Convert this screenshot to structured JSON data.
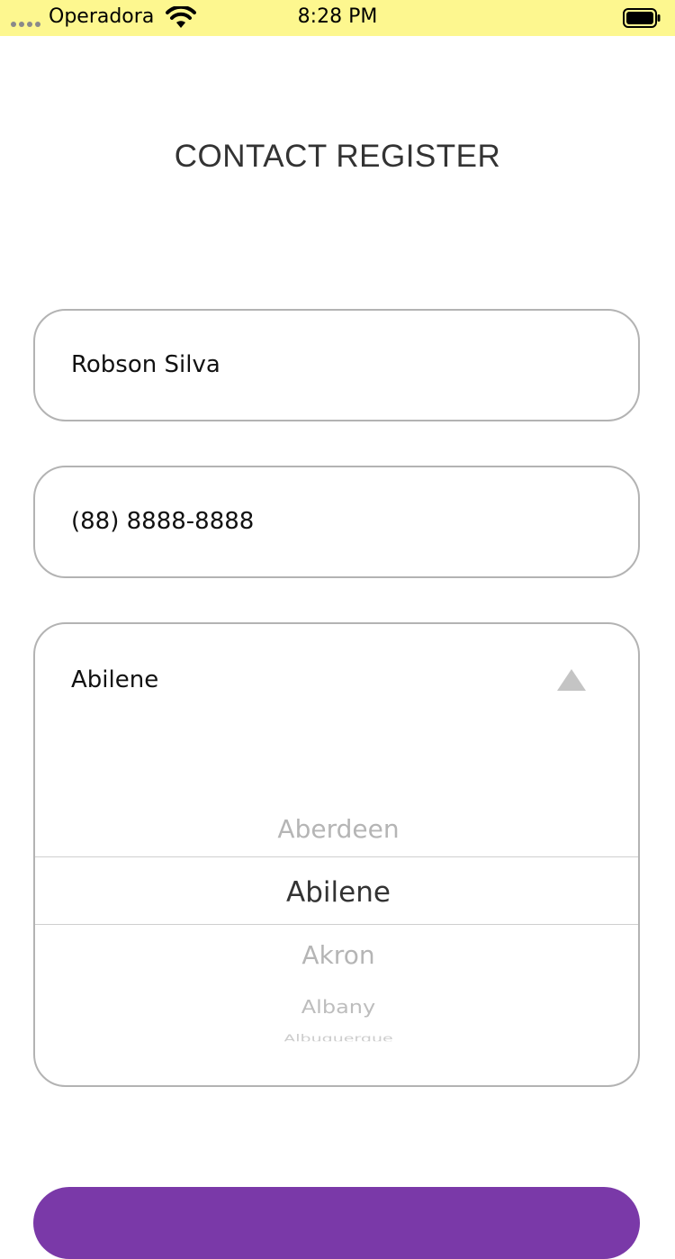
{
  "status_bar": {
    "carrier": "Operadora",
    "time": "8:28 PM",
    "signal_icon": "signal-dots-icon",
    "wifi_icon": "wifi-icon",
    "battery_icon": "battery-icon",
    "background_color": "#fdf78f"
  },
  "header": {
    "title": "CONTACT REGISTER"
  },
  "form": {
    "name_value": "Robson Silva",
    "phone_value": "(88) 8888-8888",
    "city": {
      "selected": "Abilene",
      "toggle_icon": "arrow-up-icon",
      "picker_items": [
        "Aberdeen",
        "Abilene",
        "Akron",
        "Albany",
        "Albuquerque"
      ]
    }
  },
  "colors": {
    "accent": "#7a39a8",
    "field_border": "#b3b3b3"
  }
}
